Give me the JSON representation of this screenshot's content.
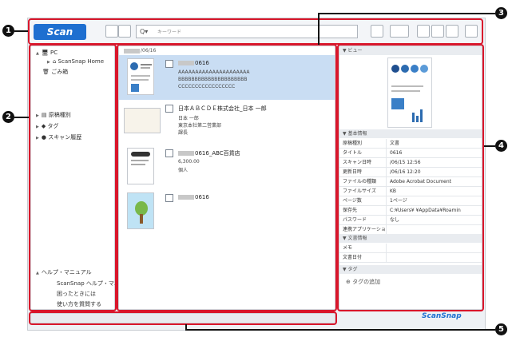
{
  "toolbar": {
    "scan_label": "Scan",
    "search_placeholder": "キーワード",
    "search_glyph": "Q▾"
  },
  "sidebar": {
    "pc": "PC",
    "home": "ScanSnap Home",
    "trash": "ごみ箱",
    "doc_type": "原稿種別",
    "tag": "タグ",
    "history": "スキャン履歴",
    "help": "ヘルプ・マニュアル",
    "help_items": [
      "ScanSnap ヘルプ・マニュアル",
      "困ったときには",
      "使い方を質問する"
    ]
  },
  "list": {
    "date_header": "/06/16",
    "rows": [
      {
        "title": "0616",
        "lines": [
          "AAAAAAAAAAAAAAAAAAAAA",
          "BBBBBBBBBBBBBBBBBBBBB",
          "CCCCCCCCCCCCCCCCC"
        ]
      },
      {
        "title": "日本ＡＢＣＤＥ株式会社_日本 一郎",
        "lines": [
          "日本 一郎",
          "東京本社第二営業部",
          "課長"
        ]
      },
      {
        "title": "0616_ABC百貨店",
        "lines": [
          "6,300.00",
          "個人"
        ]
      },
      {
        "title": "0616",
        "lines": []
      }
    ]
  },
  "viewer": {
    "view_header": "ビュー",
    "basic_header": "基本情報",
    "props": [
      {
        "k": "原稿種別",
        "v": "文書"
      },
      {
        "k": "タイトル",
        "v": "0616"
      },
      {
        "k": "スキャン日時",
        "v": "/06/15 12:56"
      },
      {
        "k": "更新日時",
        "v": "/06/16 12:20"
      },
      {
        "k": "ファイルの種類",
        "v": "Adobe Acrobat Document"
      },
      {
        "k": "ファイルサイズ",
        "v": "KB"
      },
      {
        "k": "ページ数",
        "v": "1ページ"
      },
      {
        "k": "保存先",
        "v": "C:¥Users¥ ¥AppData¥Roamin"
      },
      {
        "k": "パスワード",
        "v": "なし"
      },
      {
        "k": "連携アプリケーション",
        "v": ""
      }
    ],
    "doc_header": "文書情報",
    "doc_props": [
      {
        "k": "メモ",
        "v": ""
      },
      {
        "k": "文書日付",
        "v": ""
      }
    ],
    "tag_header": "タグ",
    "add_tag": "タグの追加"
  },
  "brand": "ScanSnap",
  "callouts": [
    "1",
    "2",
    "3",
    "4",
    "5"
  ],
  "colors": {
    "accent": "#1e6fd0",
    "selection": "#c9ddf3",
    "highlight": "#d9162b"
  }
}
